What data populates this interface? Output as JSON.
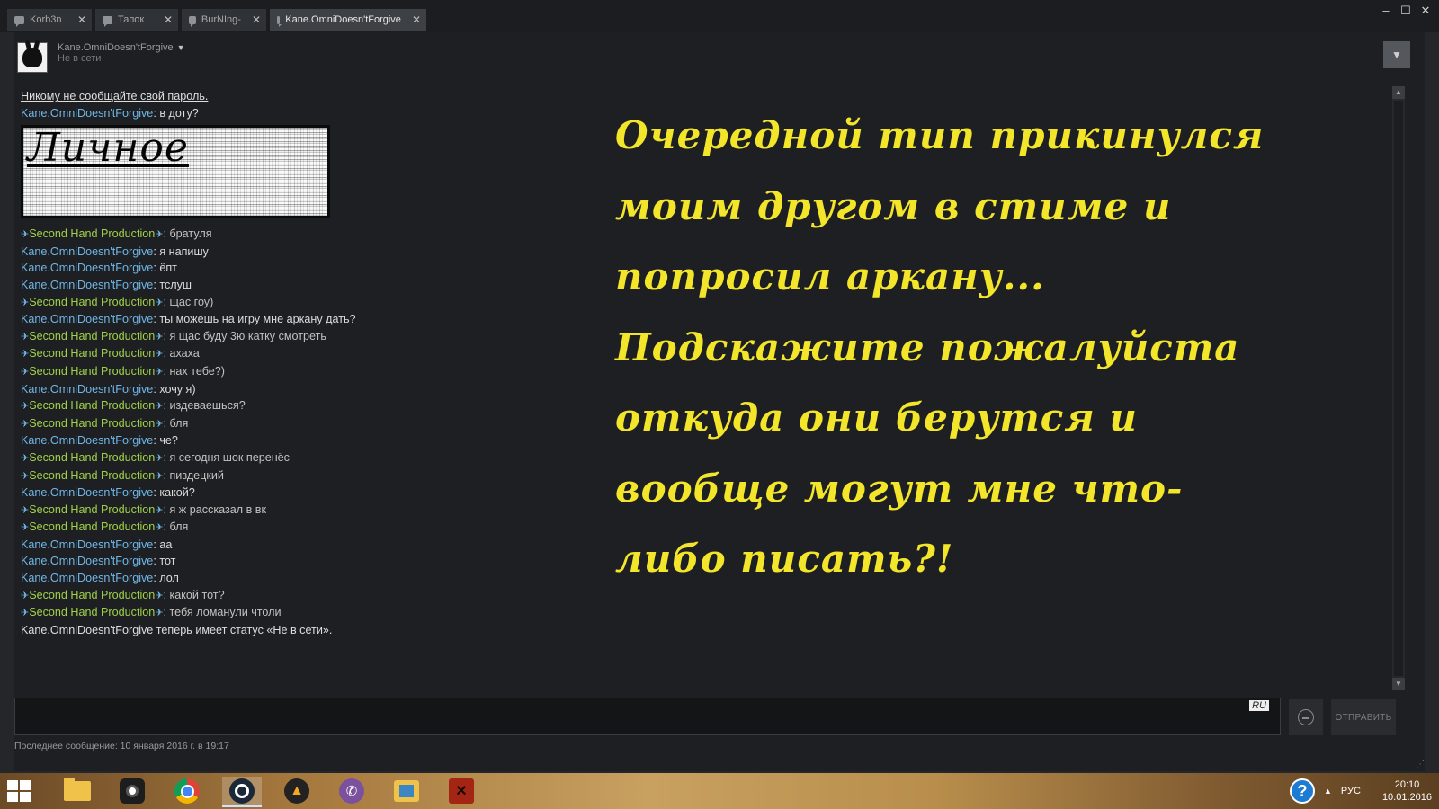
{
  "tabs": [
    {
      "label": "Korb3n",
      "active": false
    },
    {
      "label": "Тапок",
      "active": false
    },
    {
      "label": "BurNIng-",
      "active": false
    },
    {
      "label": "Kane.OmniDoesn'tForgive",
      "active": true
    }
  ],
  "header": {
    "friend_name": "Kane.OmniDoesn'tForgive",
    "status": "Не в сети"
  },
  "chat": {
    "warning": "Никому не сообщайте свой пароль.",
    "first_message": {
      "sender": "Kane.OmniDoesn'tForgive",
      "text": "в доту?"
    },
    "censored_block_text": "Личное",
    "friend_sender": "Second Hand Production",
    "me_sender": "Kane.OmniDoesn'tForgive",
    "messages": [
      {
        "who": "friend",
        "text": "братуля"
      },
      {
        "who": "me",
        "text": "я напишу"
      },
      {
        "who": "me",
        "text": "ёпт"
      },
      {
        "who": "me",
        "text": "тслуш"
      },
      {
        "who": "friend",
        "text": "щас гоу)"
      },
      {
        "who": "me",
        "text": "ты можешь на игру мне аркану дать?"
      },
      {
        "who": "friend",
        "text": "я щас буду 3ю катку смотреть"
      },
      {
        "who": "friend",
        "text": "ахаха"
      },
      {
        "who": "friend",
        "text": "нах тебе?)"
      },
      {
        "who": "me",
        "text": "хочу я)"
      },
      {
        "who": "friend",
        "text": "издеваешься?"
      },
      {
        "who": "friend",
        "text": "бля"
      },
      {
        "who": "me",
        "text": "че?"
      },
      {
        "who": "friend",
        "text": "я сегодня шок перенёс"
      },
      {
        "who": "friend",
        "text": "пиздецкий"
      },
      {
        "who": "me",
        "text": "какой?"
      },
      {
        "who": "friend",
        "text": "я ж рассказал в вк"
      },
      {
        "who": "friend",
        "text": "бля"
      },
      {
        "who": "me",
        "text": "аа"
      },
      {
        "who": "me",
        "text": "тот"
      },
      {
        "who": "me",
        "text": "лол"
      },
      {
        "who": "friend",
        "text": "какой тот?"
      },
      {
        "who": "friend",
        "text": "тебя ломанули чтоли"
      }
    ],
    "system_message": "Kane.OmniDoesn'tForgive теперь имеет статус «Не в сети»."
  },
  "overlay_lines": [
    "Очередной тип прикинулся",
    "моим другом в стиме и",
    "попросил аркану...",
    "Подскажите пожалуйста",
    "откуда они берутся и",
    "вообще могут мне что-",
    "либо писать?!"
  ],
  "input": {
    "lang_badge": "RU",
    "value": "",
    "send_label": "ОТПРАВИТЬ"
  },
  "footer": {
    "last_message": "Последнее сообщение: 10 января 2016 г. в 19:17"
  },
  "taskbar": {
    "apps": [
      "file-explorer",
      "webcam-app",
      "chrome",
      "steam",
      "game-launcher",
      "viber",
      "media-player",
      "dota2"
    ],
    "active_app": "steam",
    "lang": "РУС",
    "time": "20:10",
    "date": "10.01.2016"
  },
  "colors": {
    "me_name": "#6fb6e6",
    "friend_name": "#9fd14a",
    "overlay_text": "#f2e52a",
    "background": "#1e1f22"
  }
}
